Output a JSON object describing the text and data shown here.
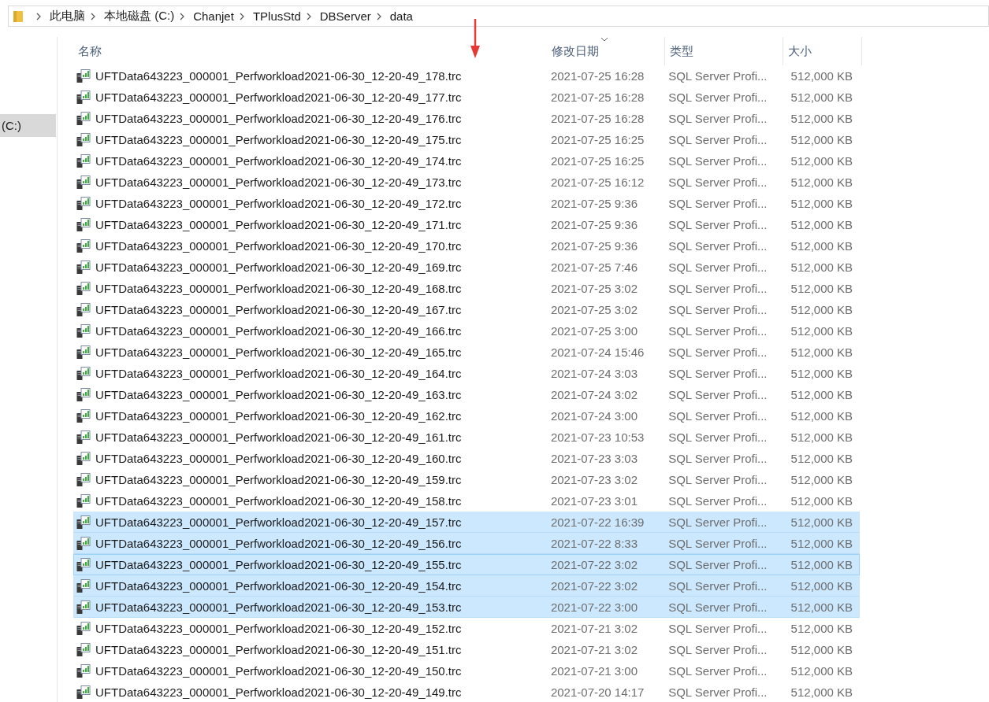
{
  "address_bar": {
    "path": [
      "此电脑",
      "本地磁盘 (C:)",
      "Chanjet",
      "TPlusStd",
      "DBServer",
      "data"
    ]
  },
  "sidebar": {
    "items": [
      {
        "label": "(C:)",
        "selected": true
      }
    ]
  },
  "table": {
    "columns": [
      {
        "label": "名称",
        "sorted": false
      },
      {
        "label": "修改日期",
        "sorted": true
      },
      {
        "label": "类型",
        "sorted": false
      },
      {
        "label": "大小",
        "sorted": false
      }
    ],
    "rows": [
      {
        "name": "UFTData643223_000001_Perfworkload2021-06-30_12-20-49_178.trc",
        "date": "2021-07-25 16:28",
        "type": "SQL Server Profi...",
        "size": "512,000 KB",
        "selected": false,
        "focused": false
      },
      {
        "name": "UFTData643223_000001_Perfworkload2021-06-30_12-20-49_177.trc",
        "date": "2021-07-25 16:28",
        "type": "SQL Server Profi...",
        "size": "512,000 KB",
        "selected": false,
        "focused": false
      },
      {
        "name": "UFTData643223_000001_Perfworkload2021-06-30_12-20-49_176.trc",
        "date": "2021-07-25 16:28",
        "type": "SQL Server Profi...",
        "size": "512,000 KB",
        "selected": false,
        "focused": false
      },
      {
        "name": "UFTData643223_000001_Perfworkload2021-06-30_12-20-49_175.trc",
        "date": "2021-07-25 16:25",
        "type": "SQL Server Profi...",
        "size": "512,000 KB",
        "selected": false,
        "focused": false
      },
      {
        "name": "UFTData643223_000001_Perfworkload2021-06-30_12-20-49_174.trc",
        "date": "2021-07-25 16:25",
        "type": "SQL Server Profi...",
        "size": "512,000 KB",
        "selected": false,
        "focused": false
      },
      {
        "name": "UFTData643223_000001_Perfworkload2021-06-30_12-20-49_173.trc",
        "date": "2021-07-25 16:12",
        "type": "SQL Server Profi...",
        "size": "512,000 KB",
        "selected": false,
        "focused": false
      },
      {
        "name": "UFTData643223_000001_Perfworkload2021-06-30_12-20-49_172.trc",
        "date": "2021-07-25 9:36",
        "type": "SQL Server Profi...",
        "size": "512,000 KB",
        "selected": false,
        "focused": false
      },
      {
        "name": "UFTData643223_000001_Perfworkload2021-06-30_12-20-49_171.trc",
        "date": "2021-07-25 9:36",
        "type": "SQL Server Profi...",
        "size": "512,000 KB",
        "selected": false,
        "focused": false
      },
      {
        "name": "UFTData643223_000001_Perfworkload2021-06-30_12-20-49_170.trc",
        "date": "2021-07-25 9:36",
        "type": "SQL Server Profi...",
        "size": "512,000 KB",
        "selected": false,
        "focused": false
      },
      {
        "name": "UFTData643223_000001_Perfworkload2021-06-30_12-20-49_169.trc",
        "date": "2021-07-25 7:46",
        "type": "SQL Server Profi...",
        "size": "512,000 KB",
        "selected": false,
        "focused": false
      },
      {
        "name": "UFTData643223_000001_Perfworkload2021-06-30_12-20-49_168.trc",
        "date": "2021-07-25 3:02",
        "type": "SQL Server Profi...",
        "size": "512,000 KB",
        "selected": false,
        "focused": false
      },
      {
        "name": "UFTData643223_000001_Perfworkload2021-06-30_12-20-49_167.trc",
        "date": "2021-07-25 3:02",
        "type": "SQL Server Profi...",
        "size": "512,000 KB",
        "selected": false,
        "focused": false
      },
      {
        "name": "UFTData643223_000001_Perfworkload2021-06-30_12-20-49_166.trc",
        "date": "2021-07-25 3:00",
        "type": "SQL Server Profi...",
        "size": "512,000 KB",
        "selected": false,
        "focused": false
      },
      {
        "name": "UFTData643223_000001_Perfworkload2021-06-30_12-20-49_165.trc",
        "date": "2021-07-24 15:46",
        "type": "SQL Server Profi...",
        "size": "512,000 KB",
        "selected": false,
        "focused": false
      },
      {
        "name": "UFTData643223_000001_Perfworkload2021-06-30_12-20-49_164.trc",
        "date": "2021-07-24 3:03",
        "type": "SQL Server Profi...",
        "size": "512,000 KB",
        "selected": false,
        "focused": false
      },
      {
        "name": "UFTData643223_000001_Perfworkload2021-06-30_12-20-49_163.trc",
        "date": "2021-07-24 3:02",
        "type": "SQL Server Profi...",
        "size": "512,000 KB",
        "selected": false,
        "focused": false
      },
      {
        "name": "UFTData643223_000001_Perfworkload2021-06-30_12-20-49_162.trc",
        "date": "2021-07-24 3:00",
        "type": "SQL Server Profi...",
        "size": "512,000 KB",
        "selected": false,
        "focused": false
      },
      {
        "name": "UFTData643223_000001_Perfworkload2021-06-30_12-20-49_161.trc",
        "date": "2021-07-23 10:53",
        "type": "SQL Server Profi...",
        "size": "512,000 KB",
        "selected": false,
        "focused": false
      },
      {
        "name": "UFTData643223_000001_Perfworkload2021-06-30_12-20-49_160.trc",
        "date": "2021-07-23 3:03",
        "type": "SQL Server Profi...",
        "size": "512,000 KB",
        "selected": false,
        "focused": false
      },
      {
        "name": "UFTData643223_000001_Perfworkload2021-06-30_12-20-49_159.trc",
        "date": "2021-07-23 3:02",
        "type": "SQL Server Profi...",
        "size": "512,000 KB",
        "selected": false,
        "focused": false
      },
      {
        "name": "UFTData643223_000001_Perfworkload2021-06-30_12-20-49_158.trc",
        "date": "2021-07-23 3:01",
        "type": "SQL Server Profi...",
        "size": "512,000 KB",
        "selected": false,
        "focused": false
      },
      {
        "name": "UFTData643223_000001_Perfworkload2021-06-30_12-20-49_157.trc",
        "date": "2021-07-22 16:39",
        "type": "SQL Server Profi...",
        "size": "512,000 KB",
        "selected": true,
        "focused": false
      },
      {
        "name": "UFTData643223_000001_Perfworkload2021-06-30_12-20-49_156.trc",
        "date": "2021-07-22 8:33",
        "type": "SQL Server Profi...",
        "size": "512,000 KB",
        "selected": true,
        "focused": false
      },
      {
        "name": "UFTData643223_000001_Perfworkload2021-06-30_12-20-49_155.trc",
        "date": "2021-07-22 3:02",
        "type": "SQL Server Profi...",
        "size": "512,000 KB",
        "selected": true,
        "focused": true
      },
      {
        "name": "UFTData643223_000001_Perfworkload2021-06-30_12-20-49_154.trc",
        "date": "2021-07-22 3:02",
        "type": "SQL Server Profi...",
        "size": "512,000 KB",
        "selected": true,
        "focused": false
      },
      {
        "name": "UFTData643223_000001_Perfworkload2021-06-30_12-20-49_153.trc",
        "date": "2021-07-22 3:00",
        "type": "SQL Server Profi...",
        "size": "512,000 KB",
        "selected": true,
        "focused": false
      },
      {
        "name": "UFTData643223_000001_Perfworkload2021-06-30_12-20-49_152.trc",
        "date": "2021-07-21 3:02",
        "type": "SQL Server Profi...",
        "size": "512,000 KB",
        "selected": false,
        "focused": false
      },
      {
        "name": "UFTData643223_000001_Perfworkload2021-06-30_12-20-49_151.trc",
        "date": "2021-07-21 3:02",
        "type": "SQL Server Profi...",
        "size": "512,000 KB",
        "selected": false,
        "focused": false
      },
      {
        "name": "UFTData643223_000001_Perfworkload2021-06-30_12-20-49_150.trc",
        "date": "2021-07-21 3:00",
        "type": "SQL Server Profi...",
        "size": "512,000 KB",
        "selected": false,
        "focused": false
      },
      {
        "name": "UFTData643223_000001_Perfworkload2021-06-30_12-20-49_149.trc",
        "date": "2021-07-20 14:17",
        "type": "SQL Server Profi...",
        "size": "512,000 KB",
        "selected": false,
        "focused": false
      }
    ]
  }
}
